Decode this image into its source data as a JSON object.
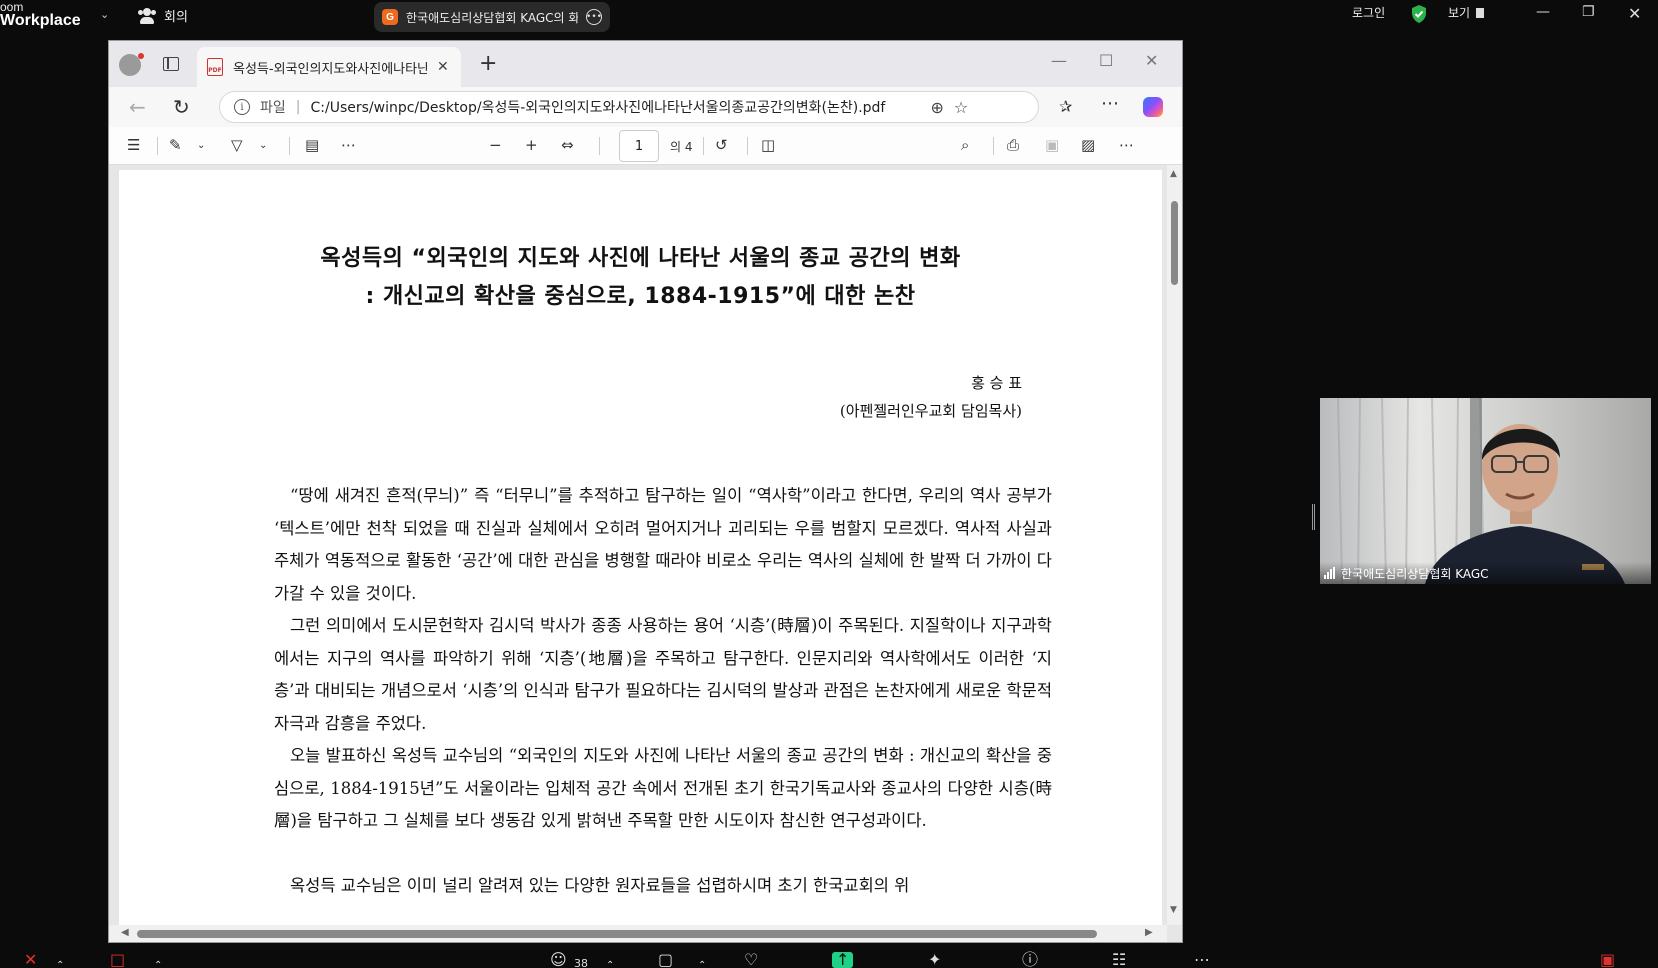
{
  "zoom": {
    "brand_line1": "oom",
    "brand_line2": "Workplace",
    "meeting_label": "회의",
    "share_title": "한국애도심리상담협회 KAGC의 화면",
    "login_label": "로그인",
    "view_label": "보기",
    "participants_count": "38",
    "colors": {
      "share_badge": "#f06a1d",
      "shield": "#2bb24c",
      "share_button": "#1fd186"
    }
  },
  "browser": {
    "tab_title": "옥성득-외국인의지도와사진에나타난서울의종교공간의변화",
    "address_scheme": "파일",
    "address_url": "C:/Users/winpc/Desktop/옥성득-외국인의지도와사진에나타난서울의종교공간의변화(논찬).pdf"
  },
  "pdf_toolbar": {
    "page_value": "1",
    "page_total": "의 4"
  },
  "document": {
    "title_line1": "옥성득의 “외국인의 지도와 사진에 나타난 서울의 종교 공간의 변화",
    "title_line2": ": 개신교의 확산을 중심으로, 1884-1915”에 대한 논찬",
    "author_name": "홍 승 표",
    "author_affiliation": "(아펜젤러인우교회 담임목사)",
    "paragraphs": [
      "“땅에 새겨진 흔적(무늬)” 즉 “터무니”를 추적하고 탐구하는 일이 “역사학”이라고 한다면, 우리의 역사 공부가 ‘텍스트’에만 천착 되었을 때 진실과 실체에서 오히려 멀어지거나 괴리되는 우를 범할지 모르겠다. 역사적 사실과 주체가 역동적으로 활동한 ‘공간’에 대한 관심을 병행할 때라야 비로소 우리는 역사의 실체에 한 발짝 더 가까이 다가갈 수 있을 것이다.",
      "그런 의미에서 도시문헌학자 김시덕 박사가 종종 사용하는 용어 ‘시층’(時層)이 주목된다. 지질학이나 지구과학에서는 지구의 역사를 파악하기 위해 ‘지층’(地層)을 주목하고 탐구한다. 인문지리와 역사학에서도 이러한 ‘지층’과 대비되는 개념으로서 ‘시층’의 인식과 탐구가 필요하다는 김시덕의 발상과 관점은 논찬자에게 새로운 학문적 자극과 감흥을 주었다.",
      "오늘 발표하신 옥성득 교수님의 “외국인의 지도와 사진에 나타난 서울의 종교 공간의 변화 : 개신교의 확산을 중심으로, 1884-1915년”도 서울이라는 입체적 공간 속에서 전개된 초기 한국기독교사와 종교사의 다양한 시층(時層)을 탐구하고 그 실체를 보다 생동감 있게 밝혀낸 주목할 만한 시도이자 참신한 연구성과이다.",
      "옥성득 교수님은 이미 널리 알려져 있는 다양한 원자료들을 섭렵하시며 초기 한국교회의 위"
    ]
  },
  "video": {
    "participant_name": "한국애도심리상담협회 KAGC"
  }
}
